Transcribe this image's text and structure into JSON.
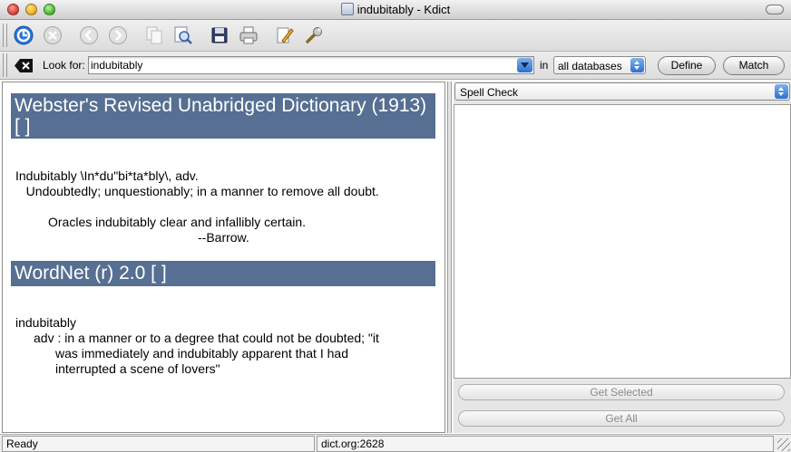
{
  "window": {
    "title": "indubitably - Kdict"
  },
  "toolbar": {
    "buttons": [
      {
        "name": "start-query-icon",
        "enabled": true
      },
      {
        "name": "stop-icon",
        "enabled": false
      },
      {
        "name": "back-icon",
        "enabled": false
      },
      {
        "name": "forward-icon",
        "enabled": false
      },
      {
        "name": "copy-icon",
        "enabled": false
      },
      {
        "name": "find-icon",
        "enabled": true
      },
      {
        "name": "save-icon",
        "enabled": true
      },
      {
        "name": "print-icon",
        "enabled": true
      },
      {
        "name": "edit-icon",
        "enabled": true
      },
      {
        "name": "settings-wrench-icon",
        "enabled": true
      }
    ]
  },
  "search": {
    "look_for_label": "Look for:",
    "query": "indubitably",
    "in_label": "in",
    "database": "all databases",
    "define_label": "Define",
    "match_label": "Match"
  },
  "results": {
    "webster": {
      "heading": "Webster's Revised Unabridged Dictionary (1913) [                   ]",
      "entry": "Indubitably \\In*du\"bi*ta*bly\\, adv.",
      "sense": "   Undoubtedly; unquestionably; in a manner to remove all doubt.",
      "quote": "Oracles indubitably clear and infallibly certain.",
      "attribution": "--Barrow."
    },
    "wordnet": {
      "heading": "WordNet (r) 2.0 [     ]",
      "word": "indubitably",
      "sense_line1": "adv : in a manner or to a degree that could not be doubted; \"it",
      "sense_line2": "was immediately and indubitably apparent that I had",
      "sense_line3": "interrupted a scene of lovers\""
    }
  },
  "side": {
    "mode": "Spell Check",
    "get_selected_label": "Get Selected",
    "get_all_label": "Get All"
  },
  "status": {
    "left": "Ready",
    "server": "dict.org:2628"
  },
  "colors": {
    "heading_bg": "#566f92",
    "accent_blue": "#2c6fd0"
  }
}
